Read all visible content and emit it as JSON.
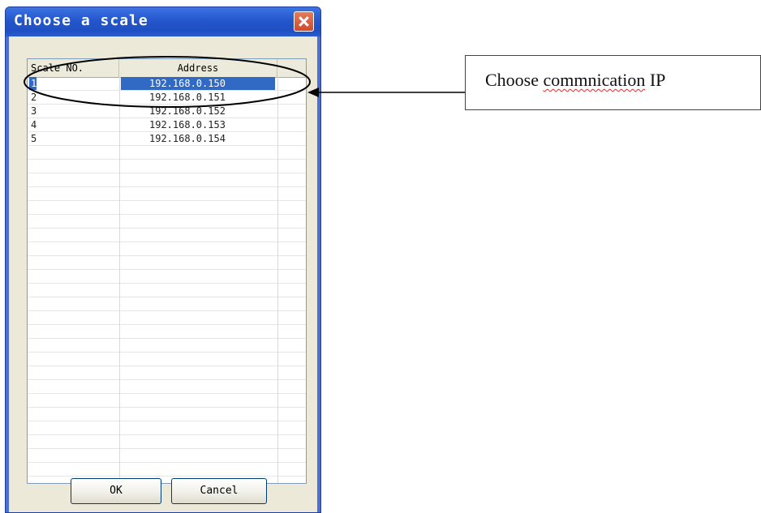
{
  "dialog": {
    "title": "Choose a scale",
    "close_icon": "close-icon",
    "columns": [
      "Scale NO.",
      "Address",
      ""
    ],
    "rows": [
      {
        "no": "1",
        "address": "192.168.0.150",
        "selected": true
      },
      {
        "no": "2",
        "address": "192.168.0.151",
        "selected": false
      },
      {
        "no": "3",
        "address": "192.168.0.152",
        "selected": false
      },
      {
        "no": "4",
        "address": "192.168.0.153",
        "selected": false
      },
      {
        "no": "5",
        "address": "192.168.0.154",
        "selected": false
      }
    ],
    "ok_label": "OK",
    "cancel_label": "Cancel"
  },
  "annotation": {
    "text_prefix": "Choose ",
    "text_misspelled": "commnication",
    "text_suffix": " IP"
  },
  "colors": {
    "titlebar": "#2457cc",
    "selection": "#316ac5",
    "dialog_face": "#ece9d8"
  }
}
